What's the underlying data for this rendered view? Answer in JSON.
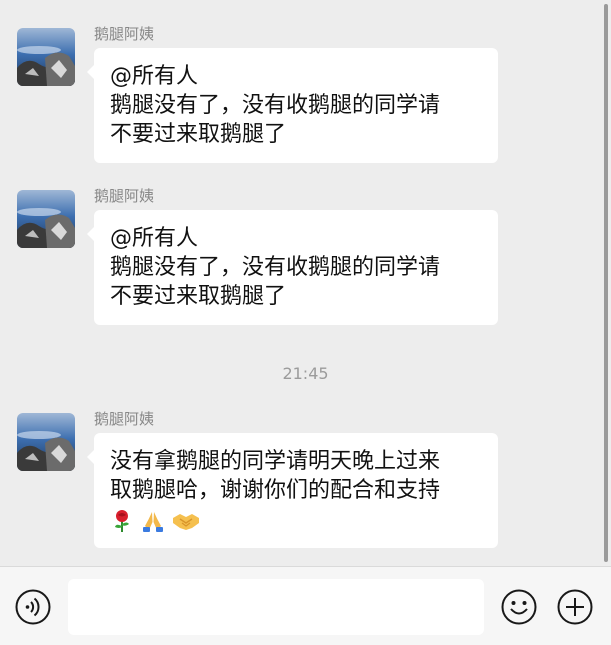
{
  "messages": [
    {
      "sender": "鹅腿阿姨",
      "lines": [
        "@所有人",
        "鹅腿没有了，没有收鹅腿的同学请",
        "不要过来取鹅腿了"
      ]
    },
    {
      "sender": "鹅腿阿姨",
      "lines": [
        "@所有人",
        "鹅腿没有了，没有收鹅腿的同学请",
        "不要过来取鹅腿了"
      ]
    },
    {
      "sender": "鹅腿阿姨",
      "lines": [
        "没有拿鹅腿的同学请明天晚上过来",
        "取鹅腿哈，谢谢你们的配合和支持"
      ],
      "emojis": [
        "rose-emoji",
        "pray-emoji",
        "handshake-emoji"
      ]
    }
  ],
  "timestamp": "21:45",
  "input_bar": {
    "icons": [
      "voice-icon",
      "emoji-face-icon",
      "plus-icon"
    ],
    "text_value": ""
  },
  "colors": {
    "background": "#ededed",
    "bubble": "#ffffff",
    "sender_text": "#888888",
    "timestamp_text": "#9b9b9b"
  }
}
